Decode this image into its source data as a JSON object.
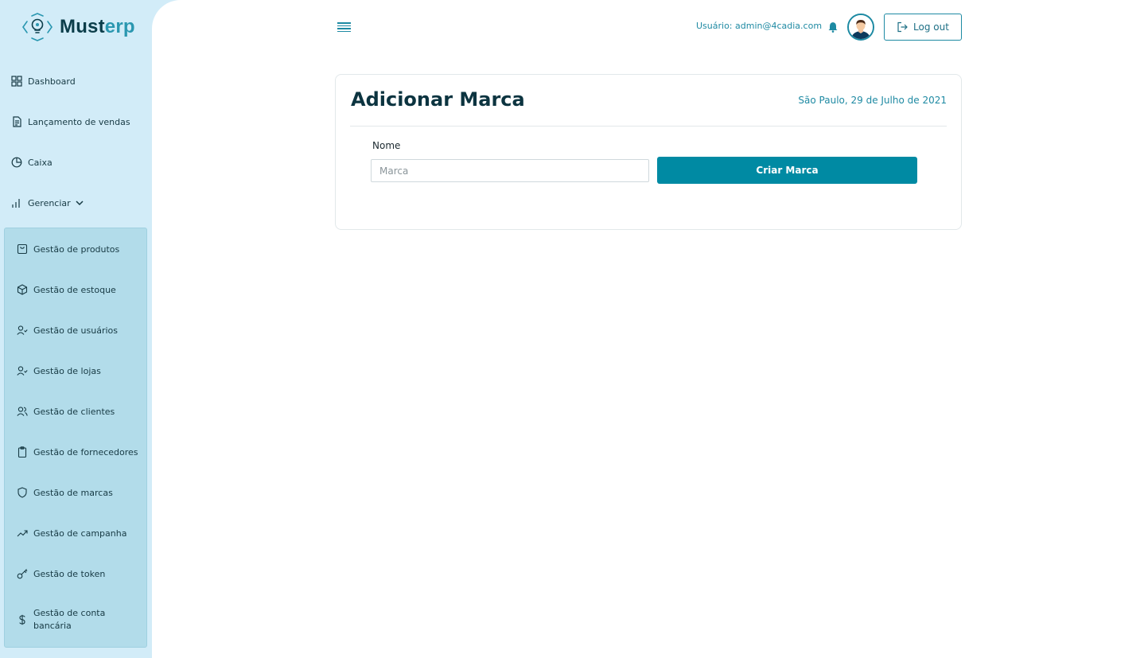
{
  "brand": {
    "name_part1": "Must",
    "name_part2": "erp"
  },
  "sidebar": {
    "items": [
      {
        "label": "Dashboard",
        "icon": "grid-icon"
      },
      {
        "label": "Lançamento de vendas",
        "icon": "document-icon"
      },
      {
        "label": "Caixa",
        "icon": "pie-chart-icon"
      },
      {
        "label": "Gerenciar",
        "icon": "bar-chart-icon"
      }
    ],
    "submenu": [
      {
        "label": "Gestão de produtos",
        "icon": "shopping-bag-icon"
      },
      {
        "label": "Gestão de estoque",
        "icon": "box-icon"
      },
      {
        "label": "Gestão de usuários",
        "icon": "user-check-icon"
      },
      {
        "label": "Gestão de lojas",
        "icon": "user-check-icon"
      },
      {
        "label": "Gestão de clientes",
        "icon": "users-icon"
      },
      {
        "label": "Gestão de fornecedores",
        "icon": "clipboard-icon"
      },
      {
        "label": "Gestão de marcas",
        "icon": "shield-icon"
      },
      {
        "label": "Gestão de campanha",
        "icon": "trending-up-icon"
      },
      {
        "label": "Gestão de token",
        "icon": "key-icon"
      },
      {
        "label": "Gestão de conta bancária",
        "icon": "dollar-icon"
      }
    ]
  },
  "header": {
    "user_label": "Usuário: admin@4cadia.com",
    "logout_label": "Log out"
  },
  "main": {
    "title": "Adicionar Marca",
    "date": "São Paulo, 29 de Julho de 2021",
    "form": {
      "name_label": "Nome",
      "name_placeholder": "Marca",
      "name_value": "",
      "submit_label": "Criar Marca"
    }
  },
  "colors": {
    "accent": "#008aa3",
    "sidebar_bg": "#d2ecf8",
    "submenu_bg": "#b2dcea",
    "title_text": "#0c3440"
  }
}
